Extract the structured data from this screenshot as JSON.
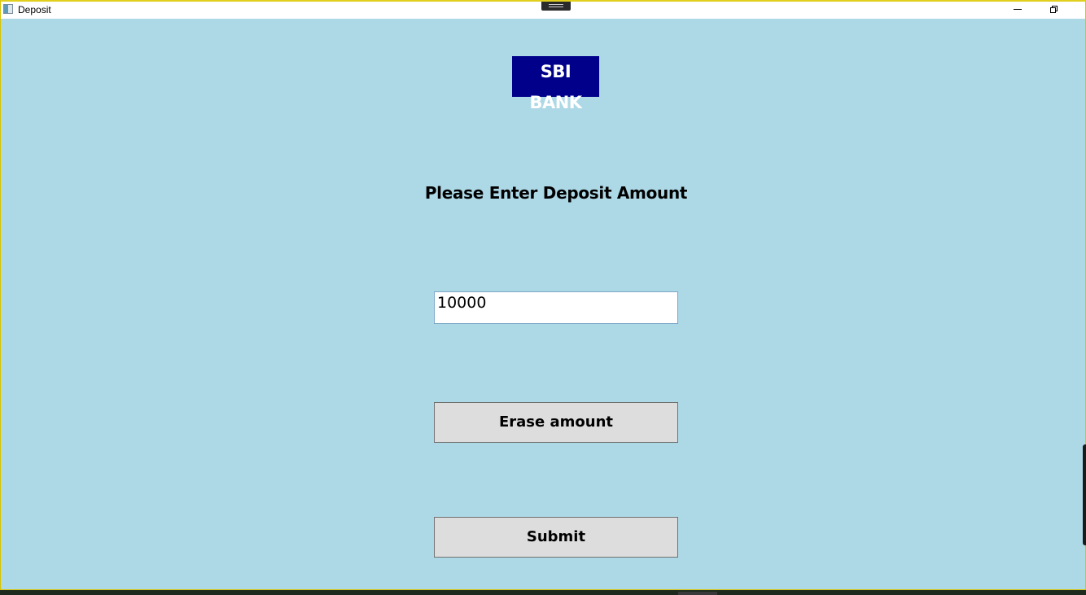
{
  "window": {
    "title": "Deposit",
    "title_icon": "window-app-icon",
    "controls": [
      "minimize-icon",
      "restore-icon"
    ]
  },
  "logo": {
    "text": "SBI BANK",
    "background": "#00008b",
    "color": "#ffffff"
  },
  "form": {
    "heading": "Please Enter Deposit Amount",
    "amount_value": "10000",
    "erase_label": "Erase amount",
    "submit_label": "Submit"
  },
  "colors": {
    "background": "#add8e6",
    "button": "#dddddd",
    "window_border": "#d8c400"
  }
}
